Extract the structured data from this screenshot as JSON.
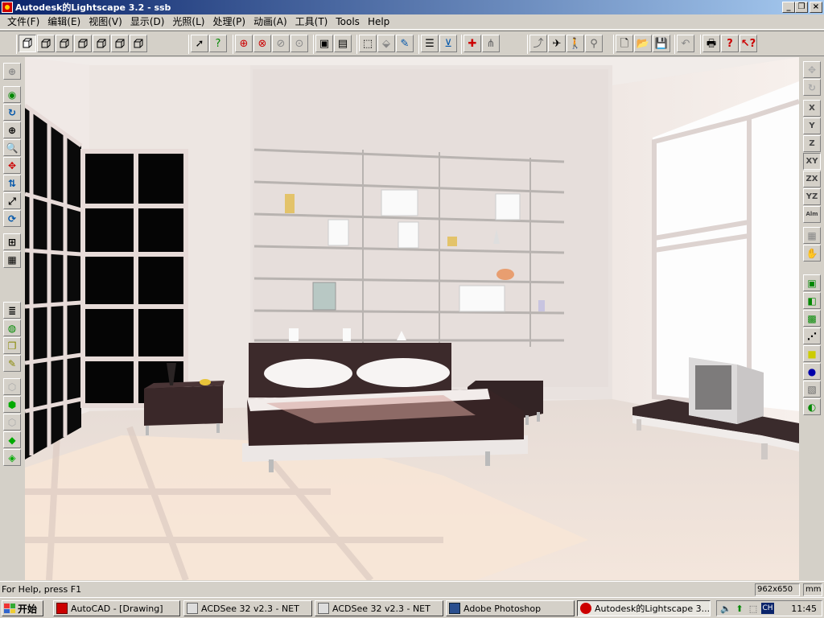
{
  "window": {
    "title": "Autodesk的Lightscape 3.2  - ssb"
  },
  "menu": [
    "文件(F)",
    "编辑(E)",
    "视图(V)",
    "显示(D)",
    "光照(L)",
    "处理(P)",
    "动画(A)",
    "工具(T)",
    "Tools",
    "Help"
  ],
  "axis_buttons": [
    "X",
    "Y",
    "Z",
    "XY",
    "ZX",
    "YZ",
    "Alm"
  ],
  "status": {
    "help": "For Help, press F1",
    "size": "962x650",
    "unit": "mm"
  },
  "taskbar": {
    "start": "开始",
    "tasks": [
      {
        "label": "AutoCAD - [Drawing]",
        "icon": "autocad-icon"
      },
      {
        "label": "ACDSee 32 v2.3 - NET",
        "icon": "acdsee-icon"
      },
      {
        "label": "ACDSee 32 v2.3 - NET",
        "icon": "acdsee-icon"
      },
      {
        "label": "Adobe Photoshop",
        "icon": "photoshop-icon"
      },
      {
        "label": "Autodesk的Lightscape 3....",
        "icon": "lightscape-icon",
        "active": true
      }
    ],
    "tray": {
      "ime": "CH",
      "clock": "11:45"
    }
  }
}
